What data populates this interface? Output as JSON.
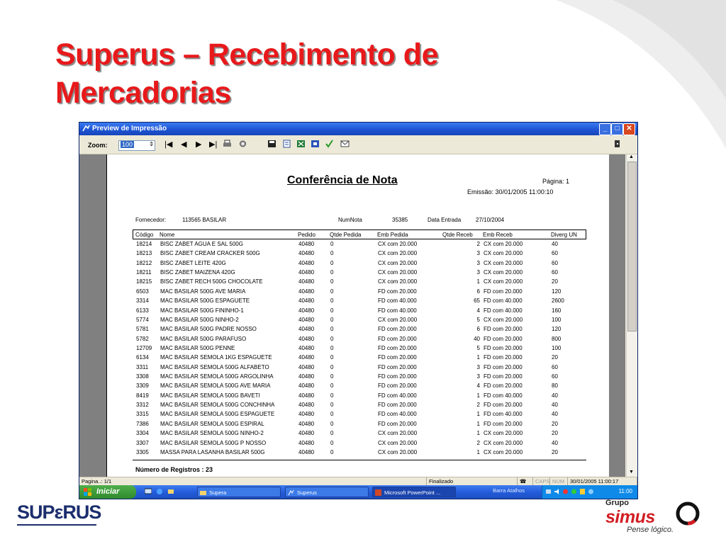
{
  "slide": {
    "title_line1": "Superus – Recebimento de",
    "title_line2": "Mercadorias",
    "logo_left": "SUPεRUS",
    "logo_right_group": "Grupo",
    "logo_right_name": "simus",
    "logo_right_tagline": "Pense lógico.",
    "title_color": "#e8191b"
  },
  "window": {
    "title": "Preview de Impressão",
    "min_icon": "minimize-icon",
    "max_icon": "maximize-icon",
    "close_icon": "close-icon"
  },
  "toolbar": {
    "zoom_label": "Zoom:",
    "zoom_value": "100",
    "buttons": [
      "first-page-icon",
      "prev-page-icon",
      "next-page-icon",
      "last-page-icon",
      "print-icon",
      "setup-icon",
      "save-icon",
      "text-export-icon",
      "excel-export-icon",
      "word-export-icon",
      "edit-icon",
      "email-icon",
      "exit-icon"
    ]
  },
  "report": {
    "title": "Conferência de Nota",
    "page_label": "Página:  1",
    "emission_label": "Emissão:  30/01/2005 11:00:10",
    "fornecedor_label": "Fornecedor:",
    "fornecedor_value": "113565  BASILAR",
    "numnota_label": "NumNota",
    "numnota_value": "35385",
    "data_entrada_label": "Data Entrada",
    "data_entrada_value": "27/10/2004",
    "columns": [
      "Código",
      "Nome",
      "Pedido",
      "Qtde Pedida",
      "Emb Pedida",
      "Qtde Receb",
      "Emb Receb",
      "Diverg UN"
    ],
    "rows": [
      [
        "18214",
        "BISC ZABET AGUA E SAL 500G",
        "40480",
        "0",
        "CX com 20.000",
        "2",
        "CX com 20.000",
        "40"
      ],
      [
        "18213",
        "BISC ZABET CREAM CRACKER 500G",
        "40480",
        "0",
        "CX com 20.000",
        "3",
        "CX com 20.000",
        "60"
      ],
      [
        "18212",
        "BISC ZABET LEITE 420G",
        "40480",
        "0",
        "CX com 20.000",
        "3",
        "CX com 20.000",
        "60"
      ],
      [
        "18211",
        "BISC ZABET MAIZENA 420G",
        "40480",
        "0",
        "CX com 20.000",
        "3",
        "CX com 20.000",
        "60"
      ],
      [
        "18215",
        "BISC ZABET RECH 500G CHOCOLATE",
        "40480",
        "0",
        "CX com 20.000",
        "1",
        "CX com 20.000",
        "20"
      ],
      [
        "6503",
        "MAC BASILAR 500G AVE MARIA",
        "40480",
        "0",
        "FD com 20.000",
        "6",
        "FD com 20.000",
        "120"
      ],
      [
        "3314",
        "MAC BASILAR 500G ESPAGUETE",
        "40480",
        "0",
        "FD com 40.000",
        "65",
        "FD com 40.000",
        "2600"
      ],
      [
        "6133",
        "MAC BASILAR 500G FININHO-1",
        "40480",
        "0",
        "FD com 40.000",
        "4",
        "FD com 40.000",
        "160"
      ],
      [
        "5774",
        "MAC BASILAR 500G NINHO-2",
        "40480",
        "0",
        "CX com 20.000",
        "5",
        "CX com 20.000",
        "100"
      ],
      [
        "5781",
        "MAC BASILAR 500G PADRE NOSSO",
        "40480",
        "0",
        "FD com 20.000",
        "6",
        "FD com 20.000",
        "120"
      ],
      [
        "5782",
        "MAC BASILAR 500G PARAFUSO",
        "40480",
        "0",
        "FD com 20.000",
        "40",
        "FD com 20.000",
        "800"
      ],
      [
        "12709",
        "MAC BASILAR 500G PENNE",
        "40480",
        "0",
        "FD com 20.000",
        "5",
        "FD com 20.000",
        "100"
      ],
      [
        "6134",
        "MAC BASILAR SEMOLA 1KG ESPAGUETE",
        "40480",
        "0",
        "FD com 20.000",
        "1",
        "FD com 20.000",
        "20"
      ],
      [
        "3311",
        "MAC BASILAR SEMOLA 500G ALFABETO",
        "40480",
        "0",
        "FD com 20.000",
        "3",
        "FD com 20.000",
        "60"
      ],
      [
        "3308",
        "MAC BASILAR SEMOLA 500G ARGOLINHA",
        "40480",
        "0",
        "FD com 20.000",
        "3",
        "FD com 20.000",
        "60"
      ],
      [
        "3309",
        "MAC BASILAR SEMOLA 500G AVE MARIA",
        "40480",
        "0",
        "FD com 20.000",
        "4",
        "FD com 20.000",
        "80"
      ],
      [
        "8419",
        "MAC BASILAR SEMOLA 500G BAVETI",
        "40480",
        "0",
        "FD com 40.000",
        "1",
        "FD com 40.000",
        "40"
      ],
      [
        "3312",
        "MAC BASILAR SEMOLA 500G CONCHINHA",
        "40480",
        "0",
        "FD com 20.000",
        "2",
        "FD com 20.000",
        "40"
      ],
      [
        "3315",
        "MAC BASILAR SEMOLA 500G ESPAGUETE",
        "40480",
        "0",
        "FD com 40.000",
        "1",
        "FD com 40.000",
        "40"
      ],
      [
        "7386",
        "MAC BASILAR SEMOLA 500G ESPIRAL",
        "40480",
        "0",
        "FD com 20.000",
        "1",
        "FD com 20.000",
        "20"
      ],
      [
        "3304",
        "MAC BASILAR SEMOLA 500G NINHO-2",
        "40480",
        "0",
        "CX com 20.000",
        "1",
        "CX com 20.000",
        "20"
      ],
      [
        "3307",
        "MAC BASILAR SEMOLA 500G P NOSSO",
        "40480",
        "0",
        "CX com 20.000",
        "2",
        "CX com 20.000",
        "40"
      ],
      [
        "3305",
        "MASSA PARA LASANHA BASILAR 500G",
        "40480",
        "0",
        "CX com 20.000",
        "1",
        "CX com 20.000",
        "20"
      ]
    ],
    "count_label": "Número de Registros :   23"
  },
  "statusbar": {
    "page": "Pagina..: 1/1",
    "status": "Finalizado",
    "caps": "CAPS",
    "num": "NUM",
    "datetime": "30/01/2005 11:00:17"
  },
  "taskbar": {
    "start": "Iniciar",
    "tasks": [
      "Supera",
      "Superus",
      "Microsoft PowerPoint ..."
    ],
    "quicklaunch_label": "Barra Atalhos",
    "clock": "11:00"
  }
}
